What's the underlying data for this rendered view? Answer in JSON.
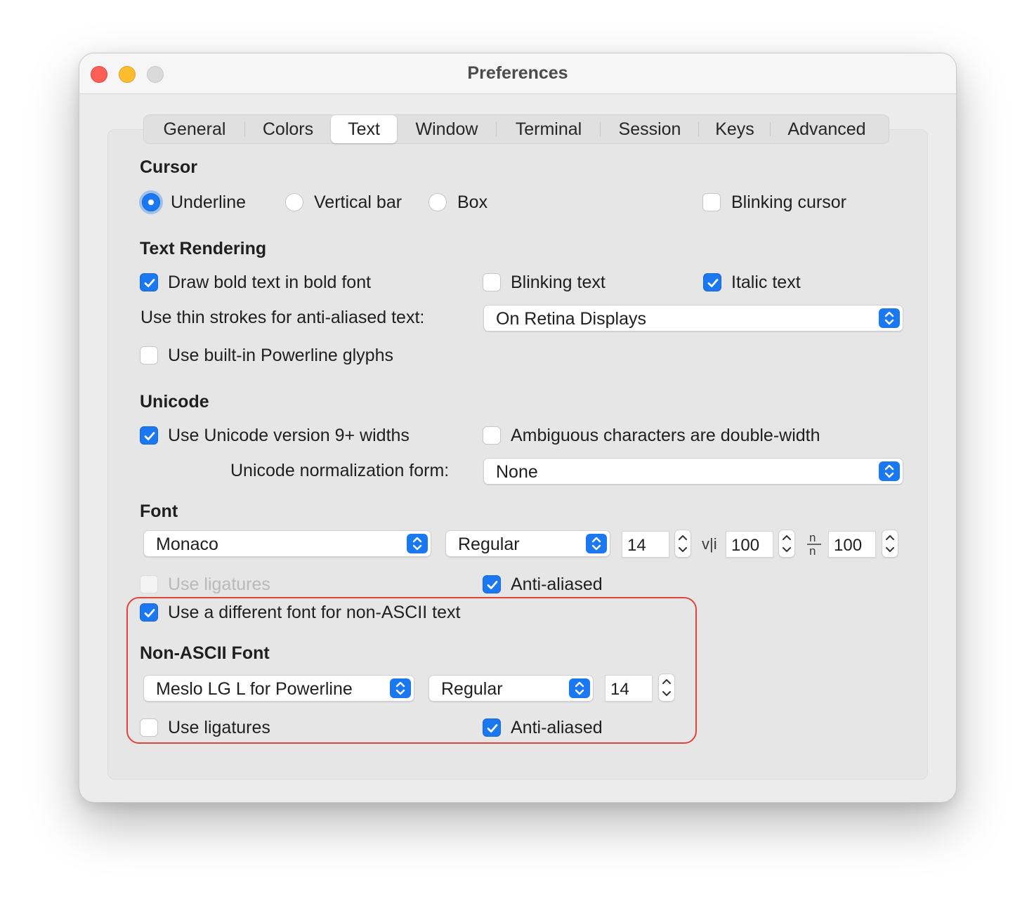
{
  "window": {
    "title": "Preferences"
  },
  "tabs": [
    {
      "label": "General",
      "active": false
    },
    {
      "label": "Colors",
      "active": false
    },
    {
      "label": "Text",
      "active": true
    },
    {
      "label": "Window",
      "active": false
    },
    {
      "label": "Terminal",
      "active": false
    },
    {
      "label": "Session",
      "active": false
    },
    {
      "label": "Keys",
      "active": false
    },
    {
      "label": "Advanced",
      "active": false
    }
  ],
  "cursor": {
    "heading": "Cursor",
    "options": [
      {
        "label": "Underline",
        "selected": true
      },
      {
        "label": "Vertical bar",
        "selected": false
      },
      {
        "label": "Box",
        "selected": false
      }
    ],
    "blinking": {
      "label": "Blinking cursor",
      "checked": false
    }
  },
  "text_rendering": {
    "heading": "Text Rendering",
    "draw_bold": {
      "label": "Draw bold text in bold font",
      "checked": true
    },
    "blinking_text": {
      "label": "Blinking text",
      "checked": false
    },
    "italic_text": {
      "label": "Italic text",
      "checked": true
    },
    "thin_strokes_label": "Use thin strokes for anti-aliased text:",
    "thin_strokes_value": "On Retina Displays",
    "powerline": {
      "label": "Use built-in Powerline glyphs",
      "checked": false
    }
  },
  "unicode": {
    "heading": "Unicode",
    "widths": {
      "label": "Use Unicode version 9+ widths",
      "checked": true
    },
    "ambiguous": {
      "label": "Ambiguous characters are double-width",
      "checked": false
    },
    "normalization_label": "Unicode normalization form:",
    "normalization_value": "None"
  },
  "font": {
    "heading": "Font",
    "family": "Monaco",
    "style": "Regular",
    "size": "14",
    "vertical_spacing": "100",
    "horizontal_spacing": "100",
    "ligatures": {
      "label": "Use ligatures",
      "checked": false,
      "disabled": true
    },
    "anti_aliased": {
      "label": "Anti-aliased",
      "checked": true
    },
    "different_non_ascii": {
      "label": "Use a different font for non-ASCII text",
      "checked": true
    }
  },
  "non_ascii_font": {
    "heading": "Non-ASCII Font",
    "family": "Meslo LG L for Powerline",
    "style": "Regular",
    "size": "14",
    "ligatures": {
      "label": "Use ligatures",
      "checked": false
    },
    "anti_aliased": {
      "label": "Anti-aliased",
      "checked": true
    }
  },
  "colors": {
    "accent": "#1a78f2",
    "highlight_box": "#e0443a"
  }
}
